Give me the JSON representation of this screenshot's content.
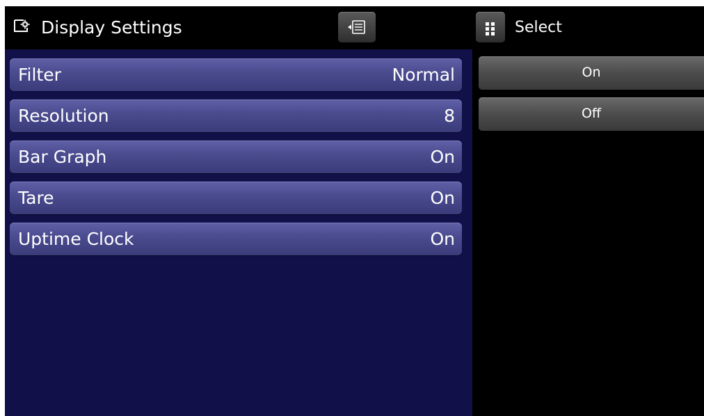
{
  "header": {
    "title": "Display Settings",
    "title_icon": "display-settings-icon",
    "menu_icon": "menu-list-icon"
  },
  "select_panel": {
    "icon": "keypad-grid-icon",
    "label": "Select",
    "options": [
      {
        "label": "On"
      },
      {
        "label": "Off"
      }
    ]
  },
  "settings": {
    "items": [
      {
        "label": "Filter",
        "value": "Normal"
      },
      {
        "label": "Resolution",
        "value": "8"
      },
      {
        "label": "Bar Graph",
        "value": "On"
      },
      {
        "label": "Tare",
        "value": "On"
      },
      {
        "label": "Uptime Clock",
        "value": "On"
      }
    ]
  },
  "colors": {
    "panel_background": "#111048",
    "row_button": "#4a4b8e",
    "option_button": "#4c4c4c",
    "screen_background": "#000000"
  }
}
